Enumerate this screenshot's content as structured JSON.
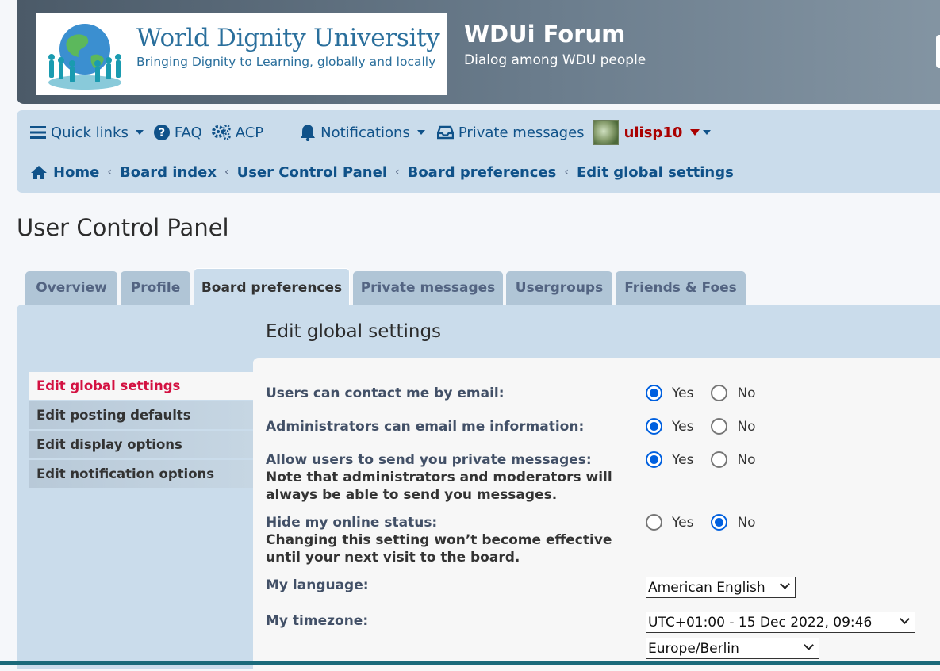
{
  "header": {
    "logo_title": "World Dignity University",
    "logo_subtitle": "Bringing Dignity to Learning, globally and locally",
    "site_title": "WDUi Forum",
    "site_description": "Dialog among WDU people"
  },
  "navbar": {
    "quick_links": "Quick links",
    "faq": "FAQ",
    "acp": "ACP",
    "notifications": "Notifications",
    "private_messages": "Private messages",
    "username": "ulisp10",
    "breadcrumbs": [
      "Home",
      "Board index",
      "User Control Panel",
      "Board preferences",
      "Edit global settings"
    ]
  },
  "page_title": "User Control Panel",
  "tabs": [
    "Overview",
    "Profile",
    "Board preferences",
    "Private messages",
    "Usergroups",
    "Friends & Foes"
  ],
  "active_tab": "Board preferences",
  "content_title": "Edit global settings",
  "side_menu": [
    "Edit global settings",
    "Edit posting defaults",
    "Edit display options",
    "Edit notification options"
  ],
  "form": {
    "yes_label": "Yes",
    "no_label": "No",
    "fields": [
      {
        "label": "Users can contact me by email:",
        "note": "",
        "value": "Yes"
      },
      {
        "label": "Administrators can email me information:",
        "note": "",
        "value": "Yes"
      },
      {
        "label": "Allow users to send you private messages:",
        "note_line1": "Note that administrators and moderators will",
        "note_line2": "always be able to send you messages.",
        "value": "Yes"
      },
      {
        "label": "Hide my online status:",
        "note_line1": "Changing this setting won’t become effective",
        "note_line2": "until your next visit to the board.",
        "value": "No"
      }
    ],
    "language_label": "My language:",
    "language_value": "American English",
    "timezone_label": "My timezone:",
    "timezone_value": "UTC+01:00 - 15 Dec 2022, 09:46",
    "timezone_region": "Europe/Berlin"
  },
  "colors": {
    "link": "#105289",
    "active_menu": "#d31141",
    "username": "#aa0000",
    "radio_checked": "#0060df"
  }
}
